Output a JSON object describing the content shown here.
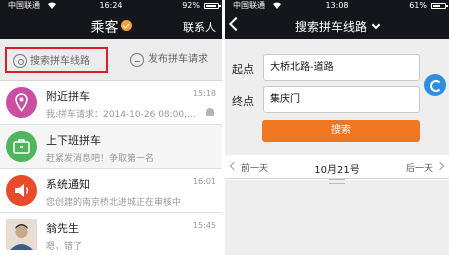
{
  "left": {
    "status": {
      "carrier": "中国联通",
      "time": "16:24",
      "battery": "92%",
      "battery_level": 0.92
    },
    "nav": {
      "title": "乘客",
      "contacts": "联系人"
    },
    "toolbar": {
      "search_label": "搜索拼车线路",
      "publish_label": "发布拼车请求"
    },
    "rows": [
      {
        "name": "附近拼车",
        "msg": "我:拼车请求：2014-10-26 08:00,...",
        "time": "15:18",
        "icon": "location-pin-icon",
        "color": "#ca4fa0"
      },
      {
        "name": "上下班拼车",
        "msg": "赶紧发消息吧！争取第一名",
        "time": "",
        "icon": "briefcase-icon",
        "color": "#4fb65d"
      },
      {
        "name": "系统通知",
        "msg": "您创建的南京桥北进城正在审核中",
        "time": "16:01",
        "icon": "speaker-icon",
        "color": "#e84a2a"
      },
      {
        "name": "翁先生",
        "msg": "嗯，错了",
        "time": "15:45",
        "icon": "user-photo",
        "color": "#c9a88a"
      }
    ]
  },
  "right": {
    "status": {
      "carrier": "中国联通",
      "time": "13:08",
      "battery": "61%",
      "battery_level": 0.61
    },
    "nav": {
      "title": "搜索拼车线路"
    },
    "form": {
      "from_label": "起点",
      "from_value": "大桥北路-道路",
      "to_label": "终点",
      "to_value": "集庆门",
      "search_button": "搜索"
    },
    "dates": {
      "prev": "前一天",
      "current": "10月21号",
      "next": "后一天"
    }
  }
}
